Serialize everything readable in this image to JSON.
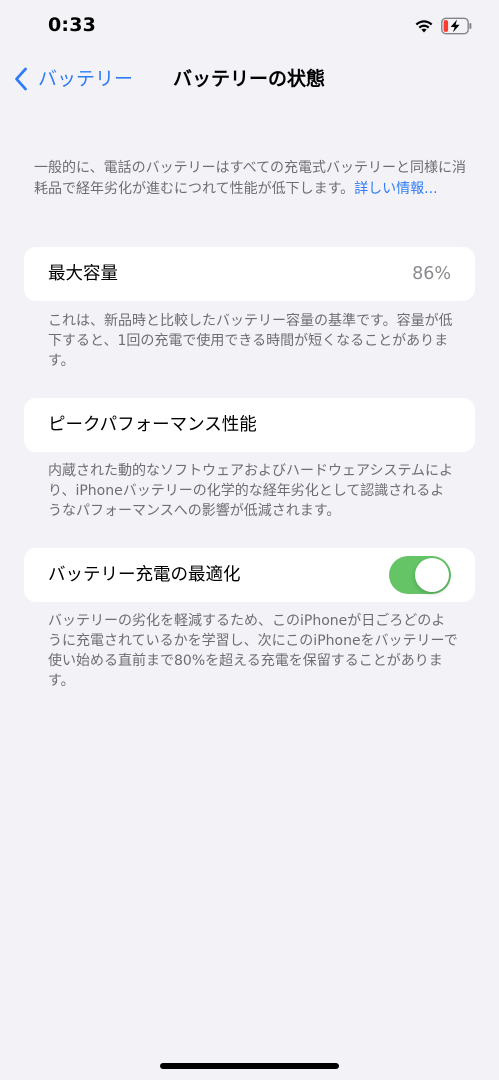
{
  "status_bar": {
    "time": "0:33",
    "wifi_icon": "wifi-icon",
    "battery_icon": "battery-charging-icon",
    "battery_color": "#FF3B30"
  },
  "nav": {
    "back_label": "バッテリー",
    "back_icon": "chevron-left-icon",
    "title": "バッテリーの状態",
    "accent_color": "#2F7CF6"
  },
  "intro": {
    "text": "一般的に、電話のバッテリーはすべての充電式バッテリーと同様に消耗品で経年劣化が進むにつれて性能が低下します。",
    "link": "詳しい情報..."
  },
  "max_capacity": {
    "label": "最大容量",
    "value": "86%",
    "footnote": "これは、新品時と比較したバッテリー容量の基準です。容量が低下すると、1回の充電で使用できる時間が短くなることがあります。"
  },
  "peak_performance": {
    "label": "ピークパフォーマンス性能",
    "footnote": "内蔵された動的なソフトウェアおよびハードウェアシステムにより、iPhoneバッテリーの化学的な経年劣化として認識されるようなパフォーマンスへの影響が低減されます。"
  },
  "optimized_charging": {
    "label": "バッテリー充電の最適化",
    "enabled": true,
    "toggle_color": "#64C466",
    "footnote": "バッテリーの劣化を軽減するため、このiPhoneが日ごろどのように充電されているかを学習し、次にこのiPhoneをバッテリーで使い始める直前まで80%を超える充電を保留することがあります。"
  }
}
